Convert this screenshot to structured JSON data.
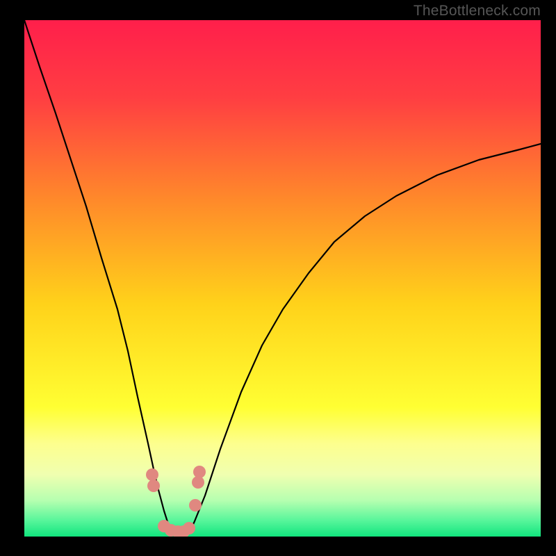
{
  "watermark": "TheBottleneck.com",
  "chart_data": {
    "type": "line",
    "title": "",
    "xlabel": "",
    "ylabel": "",
    "xlim": [
      0,
      100
    ],
    "ylim": [
      0,
      100
    ],
    "grid": false,
    "legend": false,
    "annotations": [],
    "gradient_stops": [
      {
        "pos": 0.0,
        "color": "#ff1f4b"
      },
      {
        "pos": 0.15,
        "color": "#ff3e42"
      },
      {
        "pos": 0.35,
        "color": "#ff8a2a"
      },
      {
        "pos": 0.55,
        "color": "#ffd21a"
      },
      {
        "pos": 0.75,
        "color": "#ffff33"
      },
      {
        "pos": 0.82,
        "color": "#fdff8e"
      },
      {
        "pos": 0.88,
        "color": "#f0ffb0"
      },
      {
        "pos": 0.93,
        "color": "#b6ffb0"
      },
      {
        "pos": 0.97,
        "color": "#55f59a"
      },
      {
        "pos": 1.0,
        "color": "#11e57e"
      }
    ],
    "series": [
      {
        "name": "bottleneck-curve",
        "color": "#000000",
        "x": [
          0,
          3,
          6,
          9,
          12,
          15,
          18,
          20,
          22,
          24,
          25,
          26,
          27,
          28,
          29,
          30,
          31,
          32,
          33,
          35,
          38,
          42,
          46,
          50,
          55,
          60,
          66,
          72,
          80,
          88,
          96,
          100
        ],
        "y": [
          100,
          91,
          82,
          73,
          64,
          54,
          44,
          36,
          27,
          18,
          13,
          9,
          5,
          2,
          1,
          0,
          0,
          1,
          3,
          8,
          17,
          28,
          37,
          44,
          51,
          57,
          62,
          66,
          70,
          73,
          75,
          76
        ]
      },
      {
        "name": "fit-markers",
        "color": "#e08880",
        "type": "scatter",
        "x": [
          24.8,
          27.0,
          28.4,
          29.7,
          30.8,
          31.9,
          33.1,
          33.6
        ],
        "y": [
          12.0,
          2.0,
          1.2,
          1.0,
          1.0,
          1.6,
          6.0,
          10.5
        ]
      }
    ]
  }
}
